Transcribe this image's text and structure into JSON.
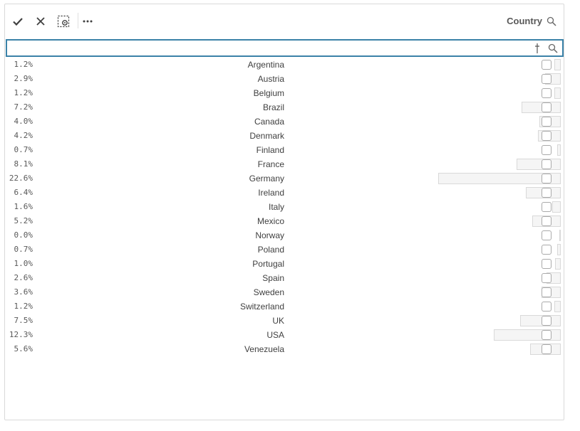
{
  "toolbar": {
    "confirm_icon": "checkmark-icon",
    "cancel_icon": "close-icon",
    "selection_icon": "lasso-select-icon",
    "more_icon": "ellipsis-icon"
  },
  "field": {
    "title": "Country"
  },
  "search": {
    "placeholder": "",
    "value": ""
  },
  "colors": {
    "accent": "#3b82a8",
    "bar_fill": "#f5f5f5",
    "bar_border": "#d9d9d9"
  },
  "list": {
    "items": [
      {
        "pct": "1.2%",
        "name": "Argentina",
        "share": 1.2
      },
      {
        "pct": "2.9%",
        "name": "Austria",
        "share": 2.9
      },
      {
        "pct": "1.2%",
        "name": "Belgium",
        "share": 1.2
      },
      {
        "pct": "7.2%",
        "name": "Brazil",
        "share": 7.2
      },
      {
        "pct": "4.0%",
        "name": "Canada",
        "share": 4.0
      },
      {
        "pct": "4.2%",
        "name": "Denmark",
        "share": 4.2
      },
      {
        "pct": "0.7%",
        "name": "Finland",
        "share": 0.7
      },
      {
        "pct": "8.1%",
        "name": "France",
        "share": 8.1
      },
      {
        "pct": "22.6%",
        "name": "Germany",
        "share": 22.6
      },
      {
        "pct": "6.4%",
        "name": "Ireland",
        "share": 6.4
      },
      {
        "pct": "1.6%",
        "name": "Italy",
        "share": 1.6
      },
      {
        "pct": "5.2%",
        "name": "Mexico",
        "share": 5.2
      },
      {
        "pct": "0.0%",
        "name": "Norway",
        "share": 0.0
      },
      {
        "pct": "0.7%",
        "name": "Poland",
        "share": 0.7
      },
      {
        "pct": "1.0%",
        "name": "Portugal",
        "share": 1.0
      },
      {
        "pct": "2.6%",
        "name": "Spain",
        "share": 2.6
      },
      {
        "pct": "3.6%",
        "name": "Sweden",
        "share": 3.6
      },
      {
        "pct": "1.2%",
        "name": "Switzerland",
        "share": 1.2
      },
      {
        "pct": "7.5%",
        "name": "UK",
        "share": 7.5
      },
      {
        "pct": "12.3%",
        "name": "USA",
        "share": 12.3
      },
      {
        "pct": "5.6%",
        "name": "Venezuela",
        "share": 5.6
      }
    ]
  }
}
